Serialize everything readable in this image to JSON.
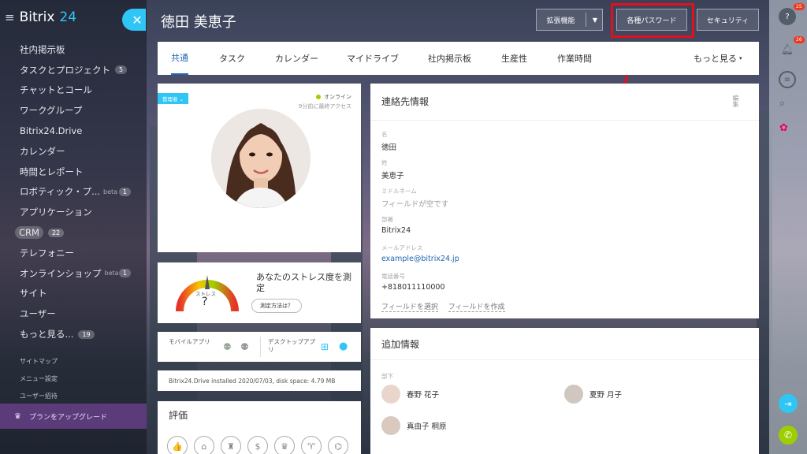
{
  "sidebar": {
    "logo_text": "Bitrix",
    "logo_num": "24",
    "close_label": "✕",
    "items": [
      {
        "label": "社内掲示板"
      },
      {
        "label": "タスクとプロジェクト",
        "count": "5"
      },
      {
        "label": "チャットとコール"
      },
      {
        "label": "ワークグループ"
      },
      {
        "label": "Bitrix24.Drive"
      },
      {
        "label": "カレンダー"
      },
      {
        "label": "時間とレポート"
      },
      {
        "label": "ロボティック・プ...",
        "beta": "beta",
        "count_right": "1"
      },
      {
        "label": "アプリケーション"
      },
      {
        "label": "CRM",
        "count": "22"
      },
      {
        "label": "テレフォニー"
      },
      {
        "label": "オンラインショップ",
        "beta": "beta",
        "count_right": "1"
      },
      {
        "label": "サイト"
      },
      {
        "label": "ユーザー"
      },
      {
        "label": "もっと見る...",
        "count": "19"
      }
    ],
    "sub_items": [
      "サイトマップ",
      "メニュー設定",
      "ユーザー招待"
    ],
    "upgrade_label": "プランをアップグレード"
  },
  "header": {
    "title": "徳田 美恵子",
    "btn_extensions": "拡張機能",
    "btn_passwords": "各種パスワード",
    "btn_security": "セキュリティ"
  },
  "tabs": [
    "共通",
    "タスク",
    "カレンダー",
    "マイドライブ",
    "社内掲示板",
    "生産性",
    "作業時間"
  ],
  "tabs_more": "もっと見る",
  "profile": {
    "admin_tag": "管理者",
    "status": "オンライン",
    "last_access": "9分前に最終アクセス"
  },
  "stress": {
    "gauge_label": "ストレス",
    "gauge_value": "?",
    "text": "あなたのストレス度を測定",
    "button": "測定方法は？"
  },
  "apps": {
    "mobile": "モバイルアプリ",
    "desktop": "デスクトップアプリ"
  },
  "drive_info": "Bitrix24.Drive installed 2020/07/03, disk space: 4.79 MB",
  "rating": {
    "title": "評価"
  },
  "contact": {
    "title": "連絡先情報",
    "edit": "編集",
    "fields": [
      {
        "key": "名",
        "value": "徳田"
      },
      {
        "key": "姓",
        "value": "美恵子"
      },
      {
        "key": "ミドルネーム",
        "value": "フィールドが空です"
      },
      {
        "key": "部署",
        "value": "Bitrix24"
      },
      {
        "key": "メールアドレス",
        "value": "example@bitrix24.jp"
      },
      {
        "key": "電話番号",
        "value": "+818011110000"
      }
    ],
    "select_field": "フィールドを選択",
    "create_field": "フィールドを作成"
  },
  "extra": {
    "title": "追加情報",
    "subordinates_label": "部下",
    "people": [
      "春野 花子",
      "夏野 月子",
      "真由子 桐原"
    ]
  },
  "rail": {
    "help_badge": "25",
    "notif_badge": "26"
  },
  "colors": {
    "accent": "#2fc6f6",
    "tab_active": "#2067b0",
    "highlight": "#e3101c",
    "online": "#9dcf00",
    "upgrade_bg": "#5b3b7a"
  }
}
